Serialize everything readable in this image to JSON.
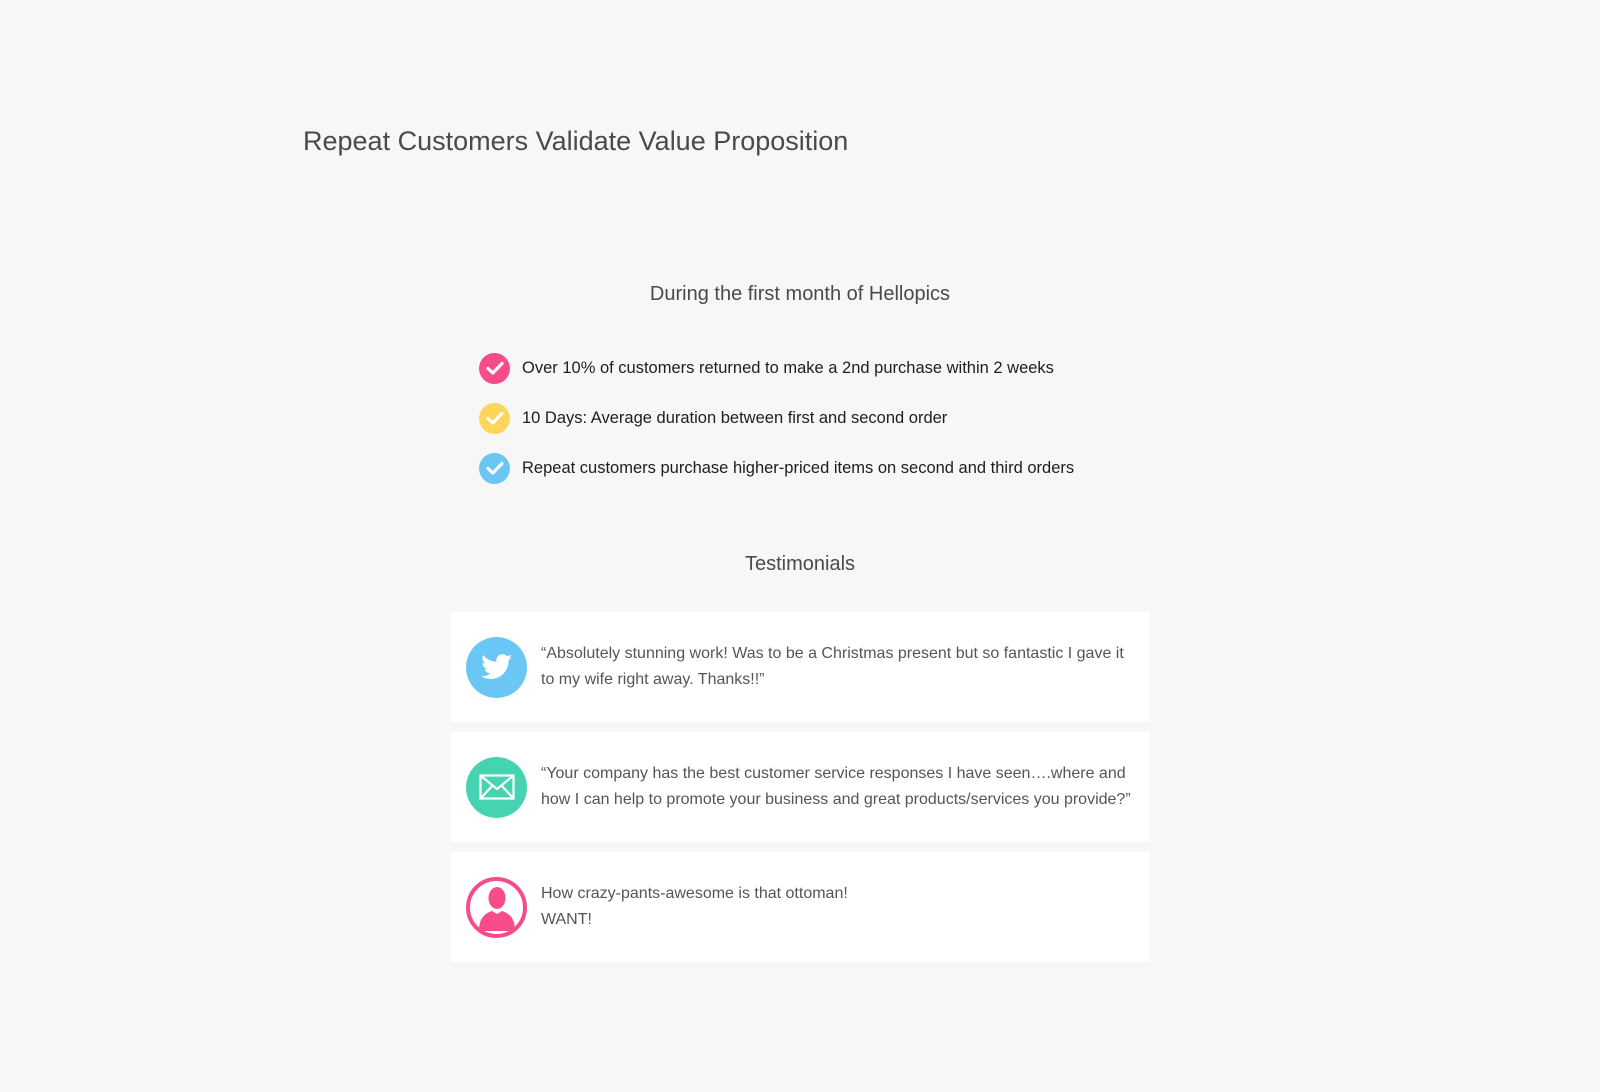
{
  "page": {
    "title": "Repeat Customers Validate Value Proposition"
  },
  "stats": {
    "heading": "During the first month of Hellopics",
    "items": [
      {
        "text": "Over 10% of customers returned to make a 2nd purchase within 2 weeks",
        "icon": "check-icon",
        "color": "#f74c8a"
      },
      {
        "text": "10 Days: Average duration between first and second order",
        "icon": "check-icon",
        "color": "#fdd55b"
      },
      {
        "text": "Repeat customers purchase higher-priced items on second and third orders",
        "icon": "check-icon",
        "color": "#6ac7f5"
      }
    ]
  },
  "testimonials": {
    "heading": "Testimonials",
    "items": [
      {
        "icon": "twitter-icon",
        "color": "#6ac7f5",
        "lines": [
          "“Absolutely stunning work! Was to be a Christmas present but so fantastic I gave it",
          "to my wife right away. Thanks!!”"
        ]
      },
      {
        "icon": "envelope-icon",
        "color": "#45d3b2",
        "lines": [
          "“Your company has the best customer service responses I have seen….where and",
          "how I can help to promote your business and great products/services you provide?”"
        ]
      },
      {
        "icon": "user-silhouette-icon",
        "color": "#f74c8a",
        "lines": [
          "How crazy-pants-awesome is that ottoman!",
          "WANT!"
        ]
      }
    ]
  }
}
